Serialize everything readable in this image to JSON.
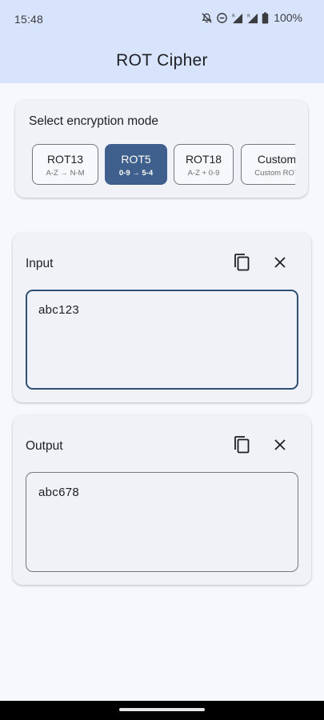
{
  "status_bar": {
    "time": "15:48",
    "battery_percent": "100%",
    "icons": [
      "mute-icon",
      "do-not-disturb-icon",
      "signal-r-icon",
      "signal-r-icon",
      "battery-icon"
    ]
  },
  "app": {
    "title": "ROT Cipher"
  },
  "mode_card": {
    "title": "Select encryption mode",
    "modes": [
      {
        "label": "ROT13",
        "sub": "A-Z → N-M",
        "selected": false
      },
      {
        "label": "ROT5",
        "sub": "0-9 → 5-4",
        "selected": true
      },
      {
        "label": "ROT18",
        "sub": "A-Z + 0-9",
        "selected": false
      },
      {
        "label": "Custom",
        "sub": "Custom ROT",
        "selected": false
      }
    ]
  },
  "input_card": {
    "label": "Input",
    "value": "abc123"
  },
  "output_card": {
    "label": "Output",
    "value": "abc678"
  },
  "colors": {
    "accent": "#3f5f8c",
    "header_bg": "#d8e4fb",
    "card_bg": "#f0f2f8",
    "focus_border": "#2d4f76"
  }
}
